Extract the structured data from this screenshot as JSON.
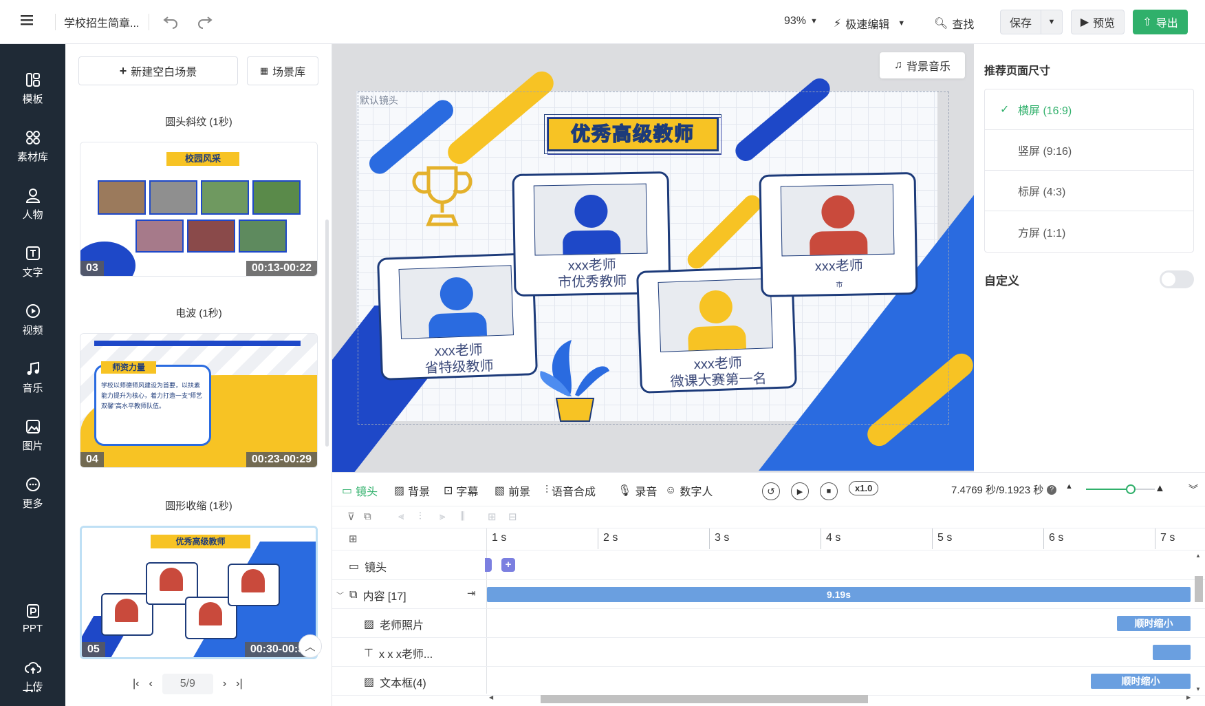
{
  "topbar": {
    "doc_title": "学校招生简章...",
    "zoom": "93%",
    "fast_edit": "极速编辑",
    "find": "查找",
    "save": "保存",
    "preview": "预览",
    "export": "导出"
  },
  "sidebar": {
    "items": [
      {
        "label": "模板"
      },
      {
        "label": "素材库"
      },
      {
        "label": "人物"
      },
      {
        "label": "文字"
      },
      {
        "label": "视频"
      },
      {
        "label": "音乐"
      },
      {
        "label": "图片"
      },
      {
        "label": "更多"
      },
      {
        "label": "PPT"
      },
      {
        "label": "上传"
      }
    ],
    "more_dots": "···"
  },
  "scenes": {
    "new_blank": "新建空白场景",
    "library": "场景库",
    "items": [
      {
        "title": "圆头斜纹 (1秒)",
        "num": "03",
        "time": "00:13-00:22",
        "thumb_heading": "校园风采"
      },
      {
        "title": "电波 (1秒)",
        "num": "04",
        "time": "00:23-00:29",
        "thumb_heading": "师资力量",
        "thumb_text": "学校以师德师风建设为首要，以扶素能力提升为核心，着力打造一支“师艺双馨”高水平教师队伍。"
      },
      {
        "title": "圆形收缩 (1秒)",
        "num": "05",
        "time": "00:30-00:39",
        "thumb_heading": "优秀高级教师"
      }
    ],
    "pager": "5/9"
  },
  "canvas": {
    "bg_music": "背景音乐",
    "default_camera": "默认镜头",
    "heading": "优秀高级教师",
    "cards": [
      {
        "name": "xxx老师",
        "title": "省特级教师"
      },
      {
        "name": "xxx老师",
        "title": "市优秀教师"
      },
      {
        "name": "xxx老师",
        "title": "微课大赛第一名"
      },
      {
        "name": "xxx老师",
        "title": "市"
      }
    ]
  },
  "right_panel": {
    "title": "推荐页面尺寸",
    "sizes": [
      "横屏 (16:9)",
      "竖屏 (9:16)",
      "标屏 (4:3)",
      "方屏 (1:1)"
    ],
    "selected": "横屏 (16:9)",
    "custom": "自定义"
  },
  "timeline": {
    "tools": [
      "镜头",
      "背景",
      "字幕",
      "前景",
      "语音合成",
      "录音",
      "数字人"
    ],
    "speed": "x1.0",
    "time_readout": "7.4769 秒/9.1923 秒",
    "ticks": [
      "1 s",
      "2 s",
      "3 s",
      "4 s",
      "5 s",
      "6 s",
      "7 s"
    ],
    "tracks": [
      {
        "label": "镜头"
      },
      {
        "label": "内容 [17]",
        "bar": "9.19s"
      },
      {
        "label": "老师照片",
        "bar": "顺时缩小"
      },
      {
        "label": "x x x老师..."
      },
      {
        "label": "文本框(4)",
        "bar": "顺时缩小"
      }
    ]
  },
  "colors": {
    "accent_green": "#30b06b",
    "brand_blue": "#2f5fd6",
    "yellow": "#f7c324",
    "dark": "#1f2a36"
  }
}
